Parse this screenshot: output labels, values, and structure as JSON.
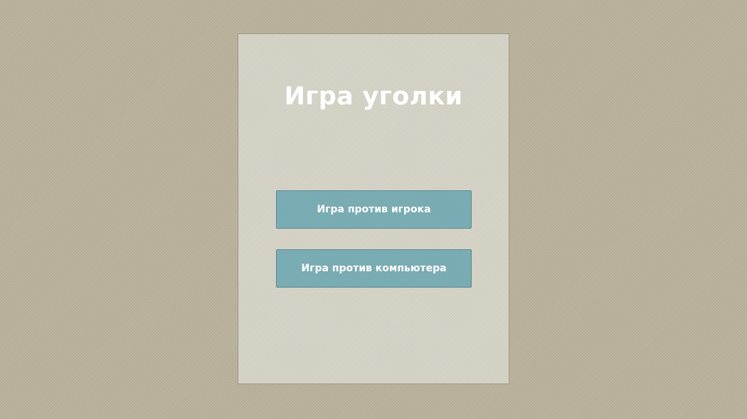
{
  "menu": {
    "title": "Игра уголки",
    "buttons": {
      "vs_player": "Игра против игрока",
      "vs_computer": "Игра против компьютера"
    }
  },
  "colors": {
    "background": "#b9b39c",
    "panel": "#d5d2c6",
    "button": "#77aab2",
    "text": "#ffffff"
  }
}
